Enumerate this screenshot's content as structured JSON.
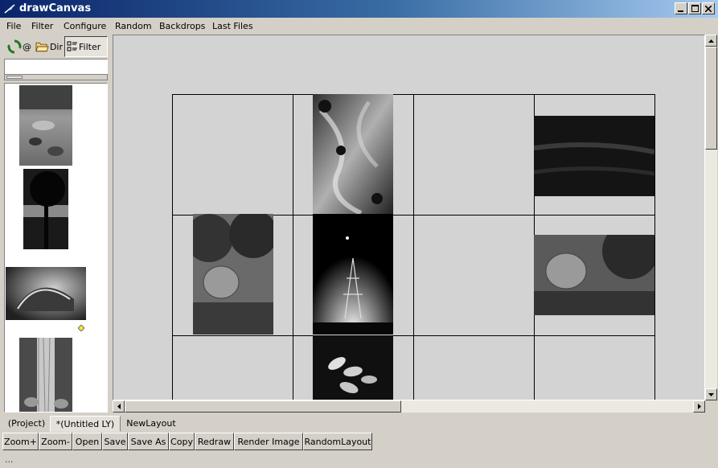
{
  "window": {
    "title": "drawCanvas"
  },
  "menu": [
    {
      "label": "File",
      "mnemonic": "F"
    },
    {
      "label": "Filter",
      "mnemonic": "F"
    },
    {
      "label": "Configure",
      "mnemonic": "C"
    },
    {
      "label": "Random",
      "mnemonic": ""
    },
    {
      "label": "Backdrops",
      "mnemonic": "B"
    },
    {
      "label": "Last Files",
      "mnemonic": ""
    }
  ],
  "left_panel": {
    "at_label": "@",
    "dir_label": "Dir",
    "filter_label": "Filter",
    "search_value": ""
  },
  "tabs": [
    {
      "label": "(Project)",
      "active": false
    },
    {
      "label": "*(Untitled LY)",
      "active": true
    },
    {
      "label": "NewLayout",
      "active": false
    }
  ],
  "buttons": [
    {
      "label": "Zoom+"
    },
    {
      "label": "Zoom-"
    },
    {
      "label": "Open"
    },
    {
      "label": "Save"
    },
    {
      "label": "Save As"
    },
    {
      "label": "Copy"
    },
    {
      "label": "Redraw"
    },
    {
      "label": "Render Image"
    },
    {
      "label": "RandomLayout"
    }
  ],
  "status": {
    "text": "..."
  },
  "colors": {
    "title_gradient_start": "#0a246a",
    "title_gradient_end": "#a6caf0",
    "canvas_bg": "#d3d3d3",
    "face": "#d4d0c8"
  },
  "icons": {
    "app": "feather-icon",
    "at": "recycle-arrows-icon",
    "dir": "open-folder-icon",
    "filter": "filter-list-icon"
  }
}
